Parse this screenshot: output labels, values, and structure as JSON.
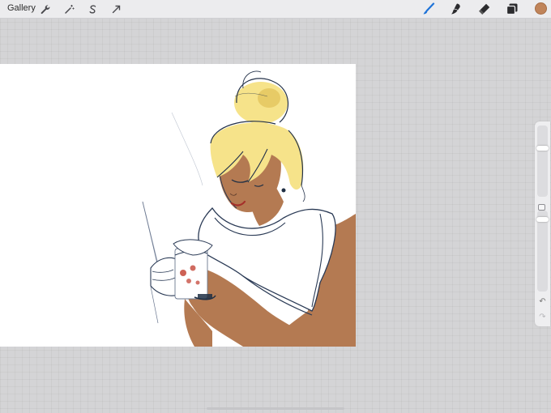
{
  "toolbar": {
    "gallery_label": "Gallery",
    "actions": [
      {
        "name": "wrench-icon",
        "tool": "actions"
      },
      {
        "name": "magic-wand-icon",
        "tool": "adjustments"
      },
      {
        "name": "selection-icon",
        "tool": "selection"
      },
      {
        "name": "transform-arrow-icon",
        "tool": "transform"
      }
    ],
    "tools": [
      {
        "name": "brush-icon",
        "tool": "paint",
        "active": true
      },
      {
        "name": "smudge-icon",
        "tool": "smudge",
        "active": false
      },
      {
        "name": "eraser-icon",
        "tool": "erase",
        "active": false
      },
      {
        "name": "layers-icon",
        "tool": "layers",
        "active": false
      }
    ],
    "current_color": "#c0845a",
    "active_tool_color": "#1e73d8"
  },
  "sidebar": {
    "brush_size_level": 0.3,
    "opacity_level": 0.08,
    "undo_icon": "undo-icon",
    "redo_icon": "redo-icon"
  },
  "canvas": {
    "content": "sketch-illustration",
    "palette": {
      "hair": "#f6e38a",
      "skin": "#b47a52",
      "line": "#1f2f44",
      "shirt": "#ffffff",
      "accent": "#c0392b"
    }
  }
}
